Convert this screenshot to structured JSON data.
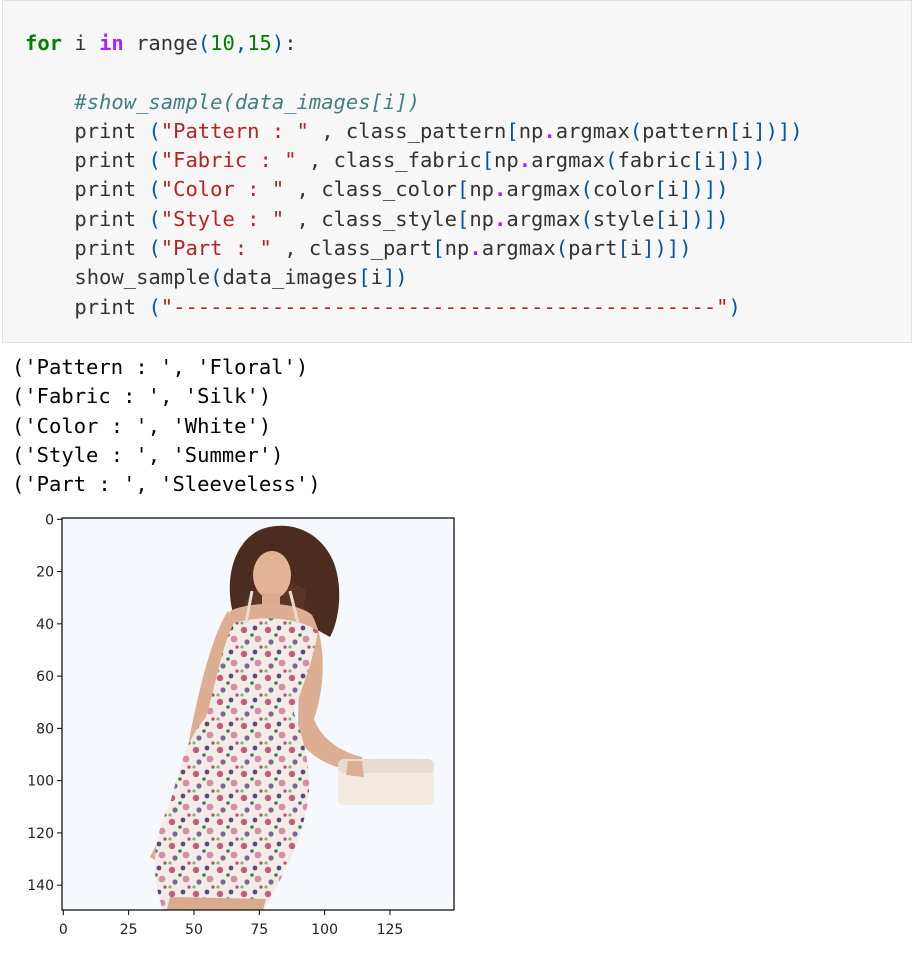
{
  "code": {
    "line1": {
      "kw_for": "for",
      "var": " i ",
      "kw_in": "in",
      "call": " range",
      "open": "(",
      "a": "10",
      "comma": ",",
      "b": "15",
      "close": ")",
      "colon": ":"
    },
    "comment": "#show_sample(data_images[i])",
    "prints": [
      {
        "kw": "print",
        "str": "\"Pattern : \"",
        "mid": " , class_pattern",
        "arg": "pattern"
      },
      {
        "kw": "print",
        "str": "\"Fabric : \"",
        "mid": " , class_fabric",
        "arg": "fabric"
      },
      {
        "kw": "print",
        "str": "\"Color : \"",
        "mid": " , class_color",
        "arg": "color"
      },
      {
        "kw": "print",
        "str": "\"Style : \"",
        "mid": " , class_style",
        "arg": "style"
      },
      {
        "kw": "print",
        "str": "\"Part : \"",
        "mid": " , class_part",
        "arg": "part"
      }
    ],
    "np": "np",
    "argmax": "argmax",
    "index_var": "i",
    "show_call": "show_sample",
    "show_arg": "data_images",
    "last_print_kw": "print",
    "dash_string": "\"--------------------------------------------\""
  },
  "output_lines": [
    "('Pattern : ', 'Floral')",
    "('Fabric : ', 'Silk')",
    "('Color : ', 'White')",
    "('Style : ', 'Summer')",
    "('Part : ', 'Sleeveless')"
  ],
  "figure": {
    "image_subject": "woman-in-floral-sleeveless-dress",
    "y_ticks": [
      0,
      20,
      40,
      60,
      80,
      100,
      120,
      140
    ],
    "x_ticks": [
      0,
      25,
      50,
      75,
      100,
      125
    ],
    "extent": [
      150,
      150
    ]
  }
}
